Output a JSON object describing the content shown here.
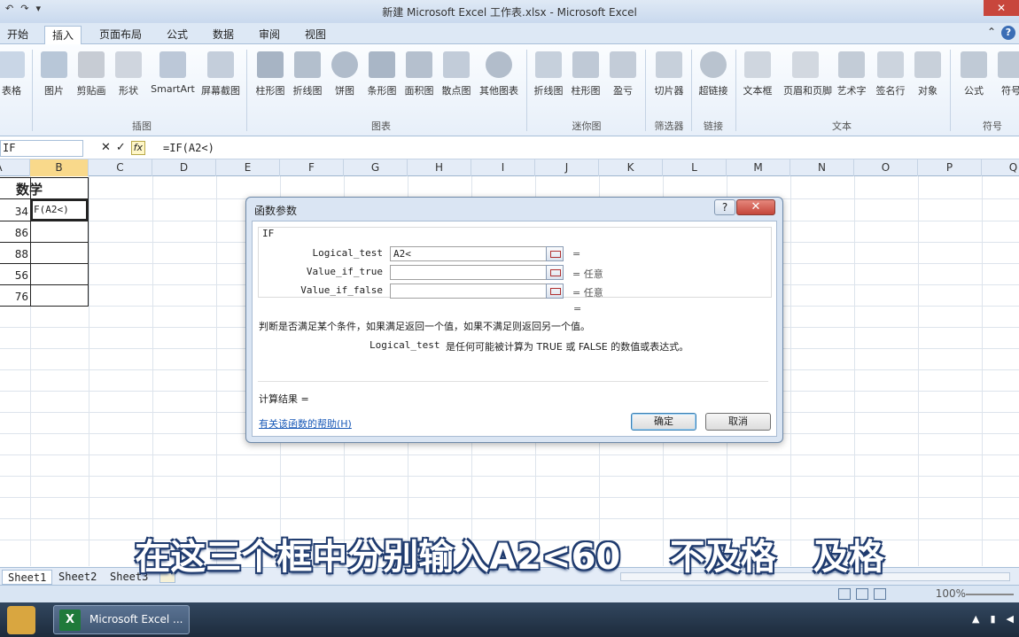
{
  "window": {
    "title": "新建 Microsoft Excel 工作表.xlsx - Microsoft Excel"
  },
  "ribbon_tabs": [
    "开始",
    "插入",
    "页面布局",
    "公式",
    "数据",
    "审阅",
    "视图"
  ],
  "ribbon": {
    "buttons": [
      "表格",
      "图片",
      "剪贴画",
      "形状",
      "SmartArt",
      "屏幕截图",
      "柱形图",
      "折线图",
      "饼图",
      "条形图",
      "面积图",
      "散点图",
      "其他图表",
      "折线图",
      "柱形图",
      "盈亏",
      "切片器",
      "超链接",
      "文本框",
      "页眉和页脚",
      "艺术字",
      "签名行",
      "对象",
      "公式",
      "符号"
    ],
    "groups": [
      "插图",
      "图表",
      "迷你图",
      "筛选器",
      "链接",
      "文本",
      "符号"
    ]
  },
  "formula_bar": {
    "name_box": "IF",
    "formula": "=IF(A2<)"
  },
  "grid": {
    "columns": [
      "A",
      "B",
      "C",
      "D",
      "E",
      "F",
      "G",
      "H",
      "I",
      "J",
      "K",
      "L",
      "M",
      "N",
      "O",
      "P",
      "Q"
    ],
    "header_cell": "数学",
    "a_values": [
      "34",
      "86",
      "88",
      "56",
      "76"
    ],
    "b2_editing": "F(A2<)"
  },
  "sheets": [
    "Sheet1",
    "Sheet2",
    "Sheet3"
  ],
  "status": {
    "zoom": "100%"
  },
  "dialog": {
    "title": "函数参数",
    "help_glyph": "?",
    "close_glyph": "✕",
    "function_name": "IF",
    "args": [
      {
        "label": "Logical_test",
        "value": "A2<",
        "result": "="
      },
      {
        "label": "Value_if_true",
        "value": "",
        "result": "= 任意"
      },
      {
        "label": "Value_if_false",
        "value": "",
        "result": "= 任意"
      }
    ],
    "overall_eq": "=",
    "description": "判断是否满足某个条件，如果满足返回一个值，如果不满足则返回另一个值。",
    "arg_desc_name": "Logical_test",
    "arg_desc_text": "是任何可能被计算为 TRUE 或 FALSE 的数值或表达式。",
    "result_label": "计算结果 =",
    "help_link": "有关该函数的帮助(H)",
    "ok": "确定",
    "cancel": "取消"
  },
  "taskbar": {
    "app_label": "Microsoft Excel ..."
  },
  "subtitle": "在这三个框中分别输入A2<60    不及格   及格",
  "colors": {
    "accent": "#3b6db5",
    "selected_col": "#f9d98b",
    "link": "#1a5ab8"
  }
}
